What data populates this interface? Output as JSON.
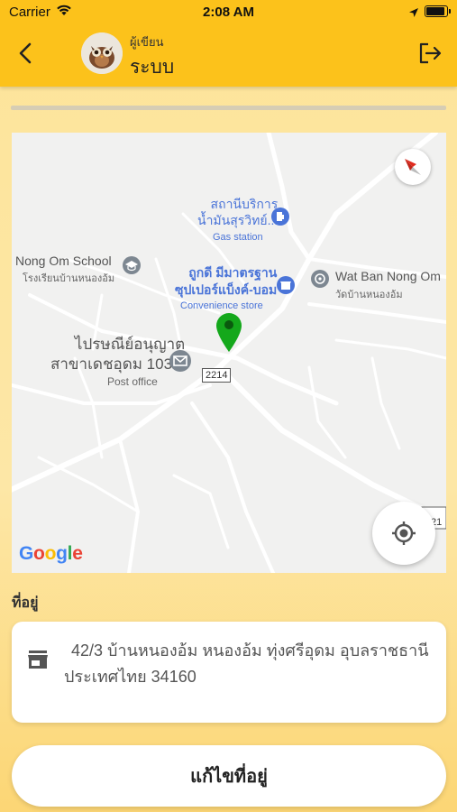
{
  "status_bar": {
    "carrier": "Carrier",
    "time": "2:08 AM",
    "battery_level": 0.95
  },
  "header": {
    "role": "ผู้เขียน",
    "username": "ระบบ"
  },
  "map": {
    "labels": {
      "gas_station_name_1": "สถานีบริการ",
      "gas_station_name_2": "น้ำมันสุรวิทย์...",
      "gas_station_type": "Gas station",
      "school_name": "Nong Om School",
      "school_name_th": "โรงเรียนบ้านหนองอ้ม",
      "store_name_1": "ถูกดี มีมาตรฐาน",
      "store_name_2": "ซุปเปอร์แบ็งค์-บอม",
      "store_type": "Convenience store",
      "temple_name": "Wat Ban Nong Om",
      "temple_name_th": "วัดบ้านหนองอ้ม",
      "post_name_1": "ไปรษณีย์อนุญาต",
      "post_name_2": "สาขาเดชอุดม 103...",
      "post_type": "Post office",
      "road_sign_1": "2214",
      "road_sign_2": "21"
    },
    "logo": "Google"
  },
  "address": {
    "label": "ที่อยู่",
    "line1": "42/3 บ้านหนองอ้ม หนองอ้ม ทุ่งศรีอุดม อุบลราชธานี",
    "line2": "ประเทศไทย 34160"
  },
  "edit_button": {
    "label": "แก้ไขที่อยู่"
  },
  "colors": {
    "header": "#fcc21b",
    "pin": "#14a81b",
    "poi_blue": "#4a74d8",
    "poi_gray": "#7d8791"
  }
}
